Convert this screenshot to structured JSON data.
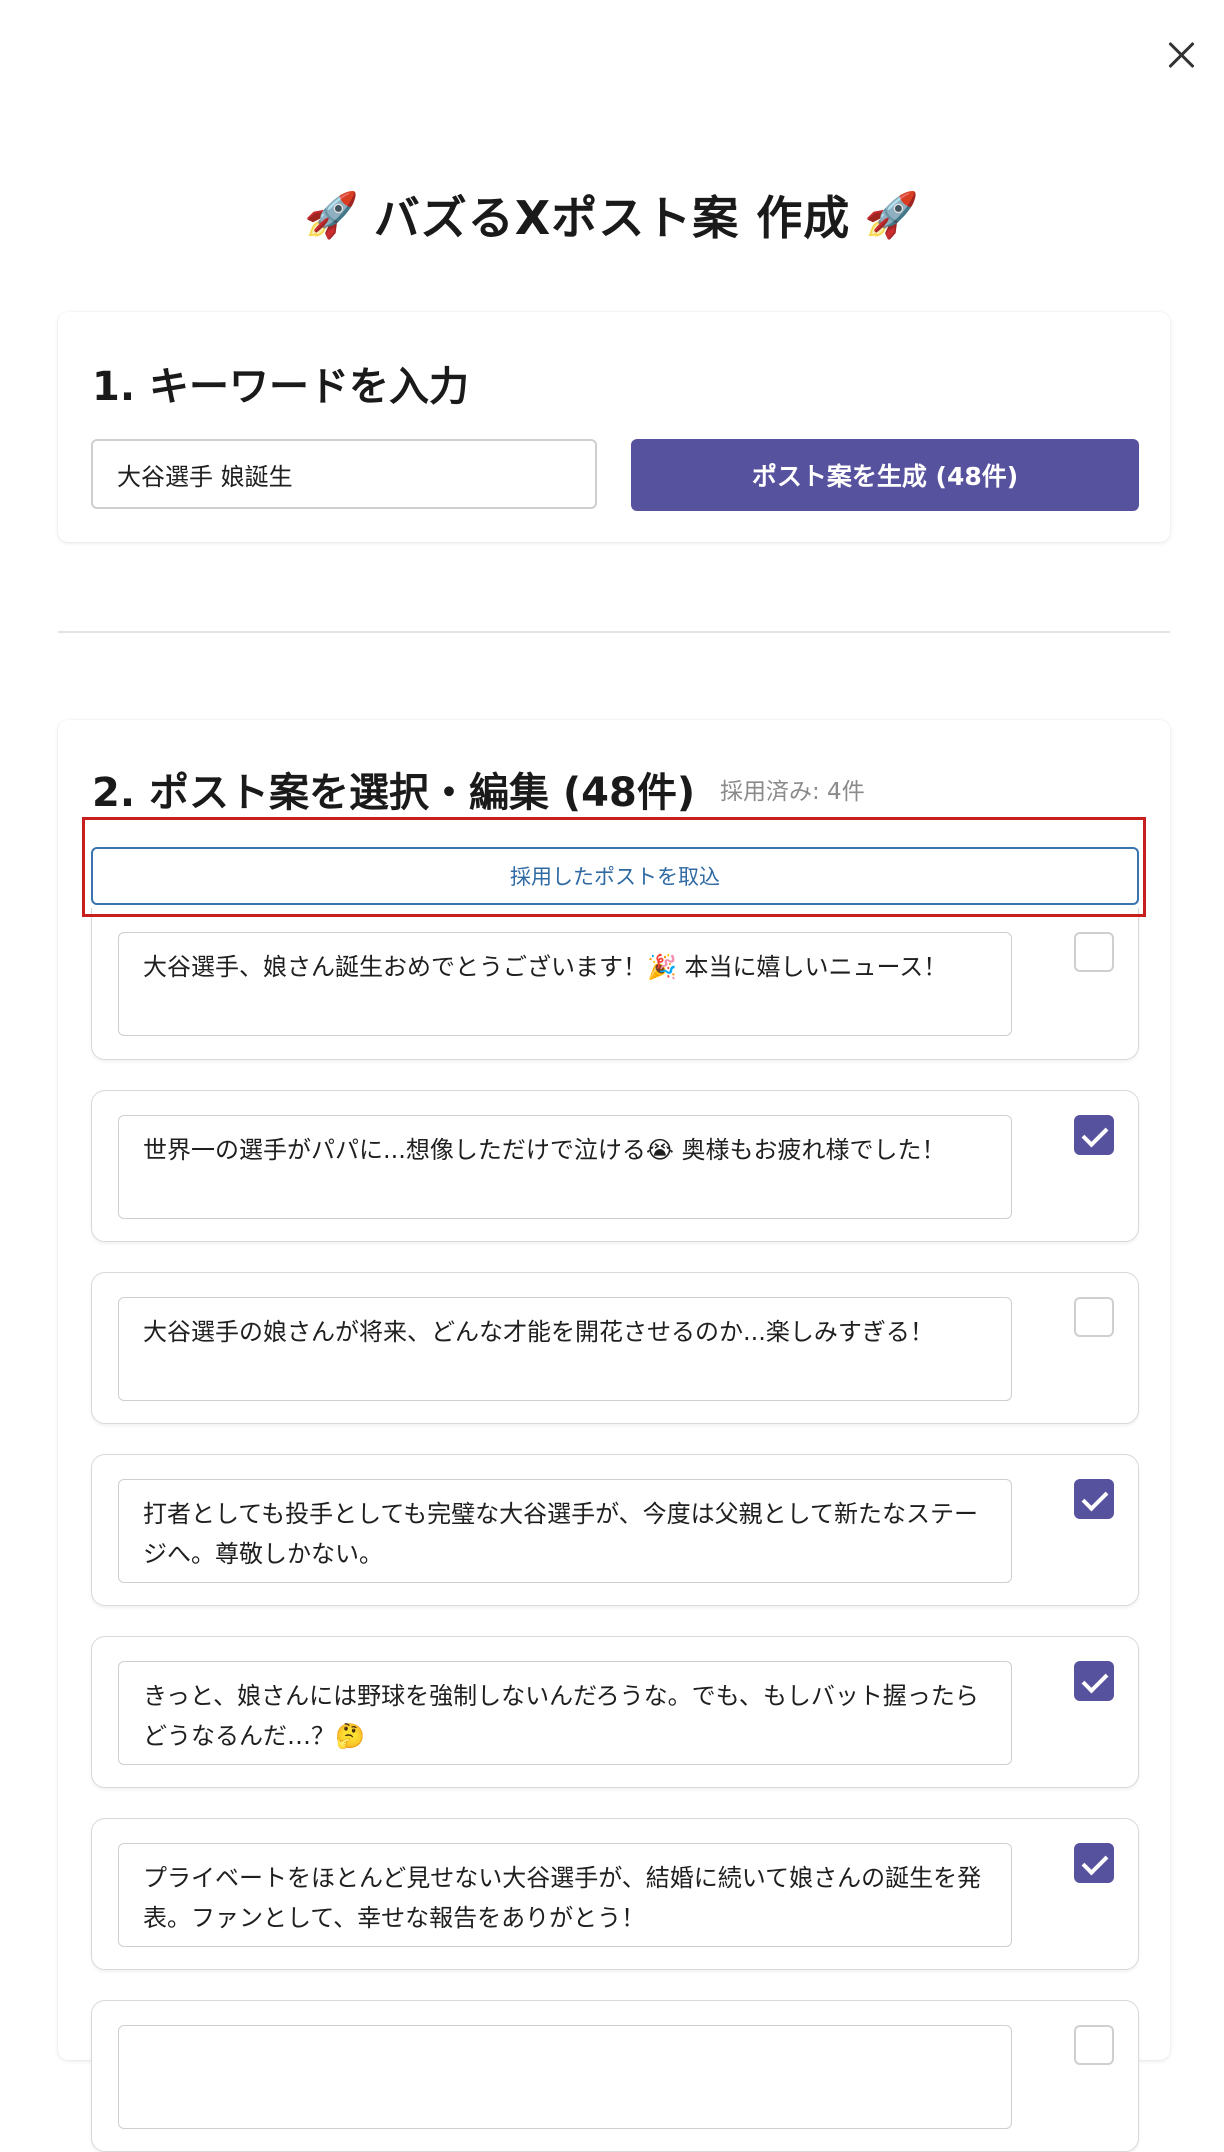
{
  "title": {
    "text": "バズるXポスト案 作成",
    "left_icon": "rocket-icon",
    "right_icon": "rocket-icon",
    "emoji": "🚀"
  },
  "close_icon": "close-icon",
  "keyword_section": {
    "title": "1. キーワードを入力",
    "input_value": "大谷選手 娘誕生",
    "generate_button": "ポスト案を生成 (48件)"
  },
  "posts_section": {
    "title": "2. ポスト案を選択・編集 (48件)",
    "adopted_count": "採用済み: 4件",
    "import_button": "採用したポストを取込",
    "posts": [
      {
        "text": "大谷選手、娘さん誕生おめでとうございます！🎉 本当に嬉しいニュース！",
        "checked": false
      },
      {
        "text": "世界一の選手がパパに...想像しただけで泣ける😭 奥様もお疲れ様でした！",
        "checked": true
      },
      {
        "text": "大谷選手の娘さんが将来、どんな才能を開花させるのか...楽しみすぎる！",
        "checked": false
      },
      {
        "text": "打者としても投手としても完璧な大谷選手が、今度は父親として新たなステージへ。尊敬しかない。",
        "checked": true
      },
      {
        "text": "きっと、娘さんには野球を強制しないんだろうな。でも、もしバット握ったらどうなるんだ…？🤔",
        "checked": true
      },
      {
        "text": "プライベートをほとんど見せない大谷選手が、結婚に続いて娘さんの誕生を発表。ファンとして、幸せな報告をありがとう！",
        "checked": true
      },
      {
        "text": "",
        "checked": false
      }
    ]
  },
  "colors": {
    "accent": "#57529e",
    "import_border": "#3a73ad",
    "highlight": "#c81e1e"
  }
}
